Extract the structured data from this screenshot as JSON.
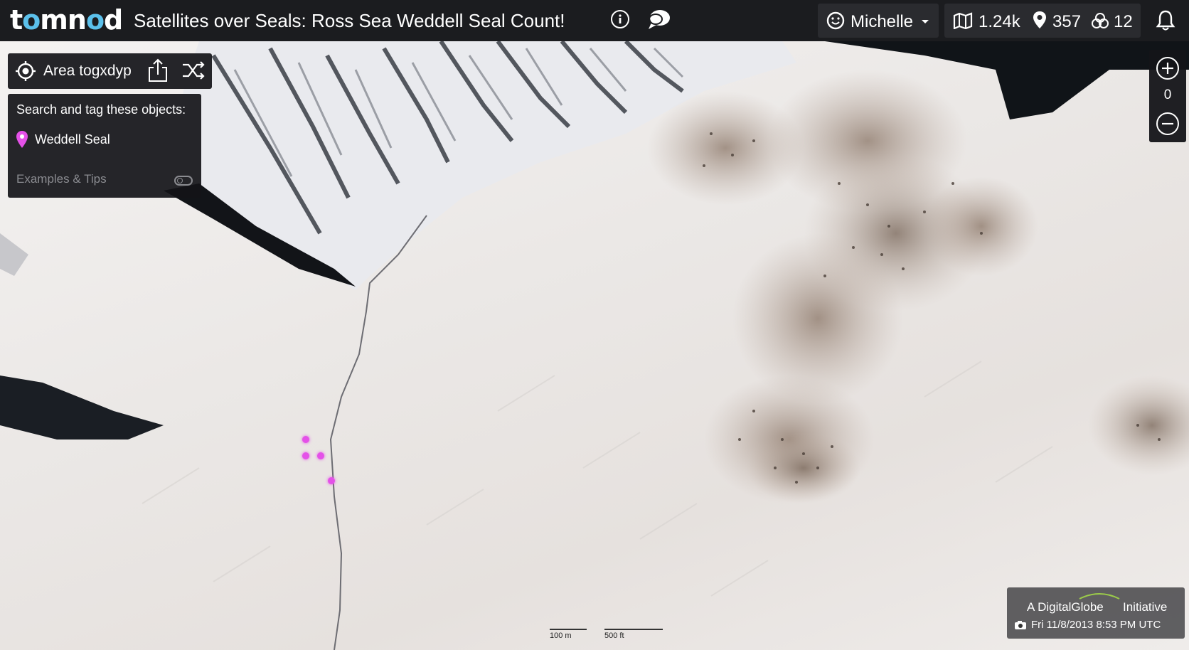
{
  "app": {
    "logo_parts": [
      "t",
      "o",
      "mn",
      "o",
      "d"
    ],
    "title": "Satellites over Seals: Ross Sea Weddell Seal Count!"
  },
  "header": {
    "info_icon": "info-icon",
    "chat_icon": "chat-icon",
    "user_name": "Michelle",
    "stats": {
      "maps": "1.24k",
      "tags": "357",
      "consensus": "12"
    },
    "bell_icon": "bell-icon"
  },
  "area": {
    "label": "Area togxdyp",
    "share_icon": "share-icon",
    "shuffle_icon": "shuffle-icon"
  },
  "task": {
    "prompt": "Search and tag these objects:",
    "tag_label": "Weddell Seal",
    "tag_color": "#e451e8",
    "tips_label": "Examples & Tips",
    "tips_enabled": false
  },
  "zoom": {
    "level": "0"
  },
  "credit": {
    "brand": "A DigitalGlobe",
    "brand_suffix": "Initiative",
    "timestamp": "Fri 11/8/2013 8:53 PM UTC"
  },
  "scale": {
    "metric": "100 m",
    "imperial": "500 ft"
  },
  "colors": {
    "topbar": "#1b1c1f",
    "accent": "#5bc0eb",
    "tag_marker": "#e451e8"
  }
}
